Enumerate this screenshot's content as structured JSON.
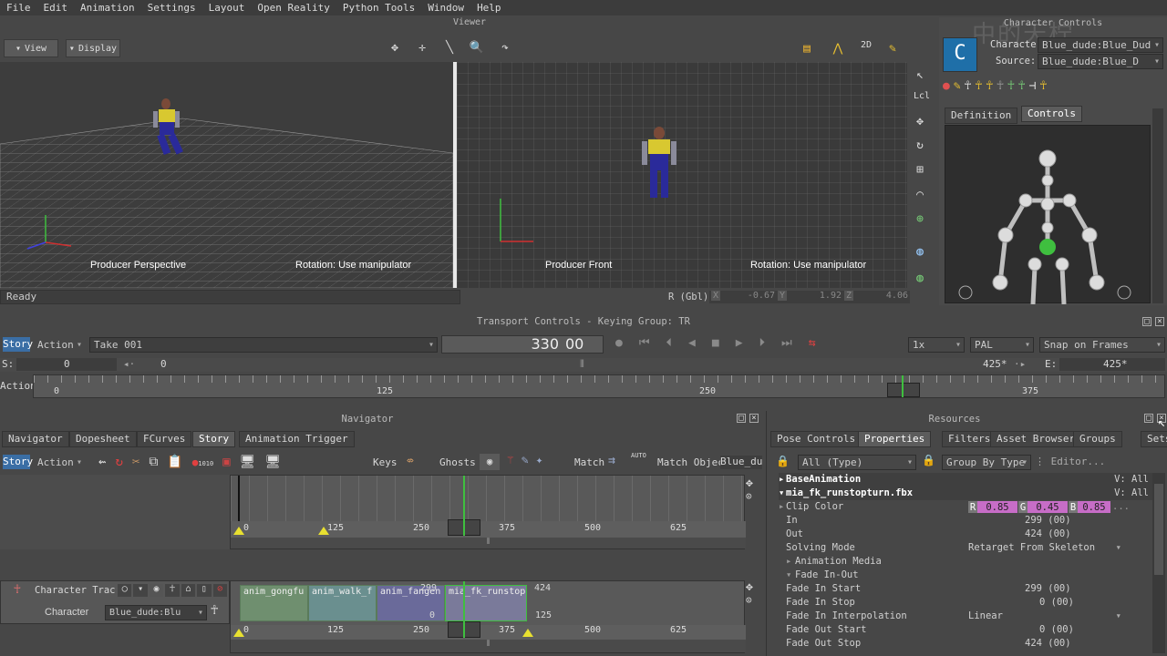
{
  "menu": [
    "File",
    "Edit",
    "Animation",
    "Settings",
    "Layout",
    "Open Reality",
    "Python Tools",
    "Window",
    "Help"
  ],
  "viewer": {
    "title": "Viewer",
    "view_btn": "View",
    "display_btn": "Display",
    "left_label": "Producer Perspective",
    "left_rot": "Rotation: Use manipulator",
    "right_label": "Producer Front",
    "right_rot": "Rotation: Use manipulator",
    "status": "Ready",
    "coord_label": "R (Gbl)",
    "coord_x_tag": "X",
    "coord_x": "-0.67",
    "coord_y_tag": "Y",
    "coord_y": "1.92",
    "coord_z_tag": "Z",
    "coord_z": "4.06",
    "lcl": "Lcl",
    "icon_2d": "2D"
  },
  "character_controls": {
    "title": "Character Controls",
    "character_label": "Character",
    "character_value": "Blue_dude:Blue_Dud",
    "source_label": "Source:",
    "source_value": "Blue_dude:Blue_D",
    "tabs": [
      "Definition",
      "Controls"
    ],
    "watermark": "中的天柠"
  },
  "transport": {
    "title": "Transport Controls  -  Keying Group: TR",
    "story_btn": "Story",
    "action_dd": "Action",
    "take_dd": "Take 001",
    "frame": "330",
    "frame_sub": "00",
    "speed": "1x",
    "format": "PAL",
    "snap": "Snap on Frames",
    "start_label": "S:",
    "start_value": "0",
    "current": "0",
    "end_marker": "425*",
    "end_label": "E:",
    "end_value": "425*",
    "action_label": "Action",
    "ruler": [
      "0",
      "125",
      "250",
      "375"
    ]
  },
  "navigator": {
    "title": "Navigator",
    "tabs": [
      "Navigator",
      "Dopesheet",
      "FCurves",
      "Story",
      "Animation Trigger"
    ],
    "story_btn": "Story",
    "action_dd": "Action",
    "keys": "Keys",
    "ghosts": "Ghosts",
    "match": "Match",
    "auto": "AUTO",
    "match_object": "Match Objec",
    "match_value": "Blue_du",
    "counter": "1010",
    "ruler": [
      "0",
      "125",
      "250",
      "375",
      "500",
      "625"
    ],
    "track_name": "Character Trac",
    "track_sub": "Character",
    "track_value": "Blue_dude:Blu",
    "clips": [
      "anim_gongfu",
      "anim_walk_f",
      "anim_fangen",
      "mia_fk_runstop"
    ],
    "clip_markers": {
      "top": "299",
      "right_top": "424",
      "left_bottom": "0",
      "right_bottom": "125"
    }
  },
  "resources": {
    "title": "Resources",
    "tabs": [
      "Pose Controls",
      "Properties",
      "Filters",
      "Asset Browser",
      "Groups",
      "Sets"
    ],
    "filter_dd": "All (Type)",
    "group_dd": "Group By Type",
    "editor": "Editor...",
    "base": "BaseAnimation",
    "base_v": "V: All",
    "file": "mia_fk_runstopturn.fbx",
    "file_v": "V: All",
    "clip_color": "Clip Color",
    "r_tag": "R",
    "r": "0.85",
    "g_tag": "G",
    "g": "0.45",
    "b_tag": "B",
    "b": "0.85",
    "dots": "...",
    "rows": [
      {
        "k": "In",
        "v": "299 (00)"
      },
      {
        "k": "Out",
        "v": "424 (00)"
      }
    ],
    "solving_mode": "Solving Mode",
    "solving_value": "Retarget From Skeleton",
    "anim_media": "Animation Media",
    "fade_inout": "Fade In-Out",
    "fade_rows": [
      {
        "k": "Fade In Start",
        "v": "299 (00)"
      },
      {
        "k": "Fade In Stop",
        "v": "0 (00)"
      }
    ],
    "fade_interp": "Fade In Interpolation",
    "fade_interp_value": "Linear",
    "fade_rows2": [
      {
        "k": "Fade Out Start",
        "v": "0 (00)"
      },
      {
        "k": "Fade Out Stop",
        "v": "424 (00)"
      }
    ]
  },
  "colors": {
    "accent": "#3a6ea5",
    "clip_pink": "#c76dc7",
    "green": "#3fbf3f"
  }
}
